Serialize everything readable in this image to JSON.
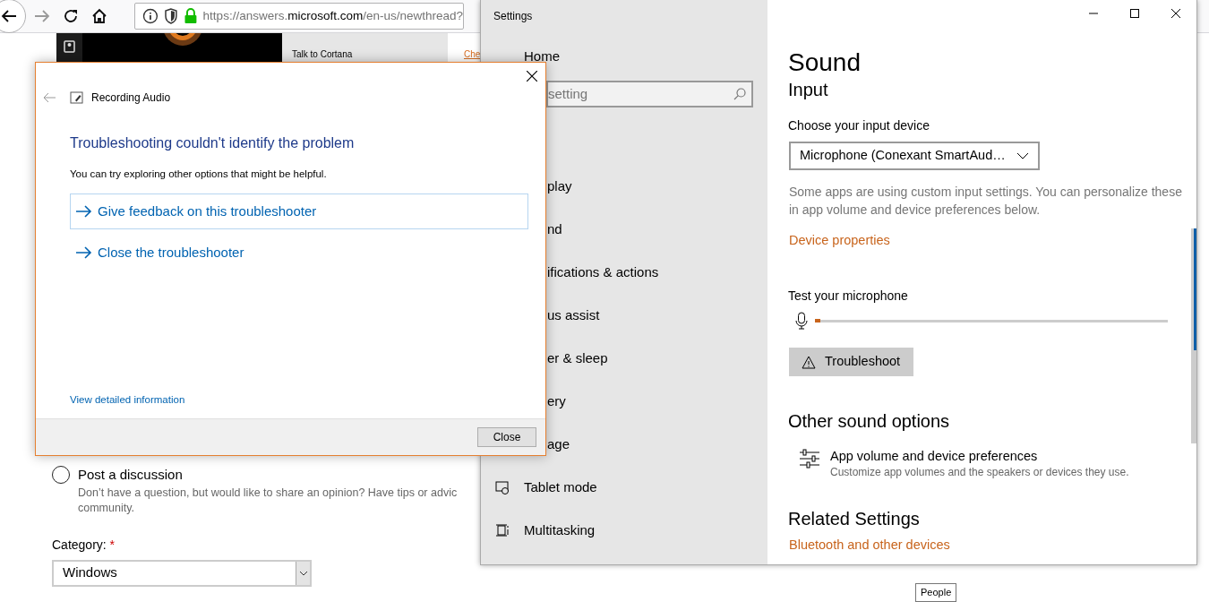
{
  "browser": {
    "address": {
      "url_prefix": "https://answers.",
      "url_host": "microsoft.com",
      "url_path": "/en-us/newthread?"
    }
  },
  "page": {
    "promo": {
      "caption": "Talk to Cortana",
      "link": "Che"
    },
    "post_option": {
      "label": "Post a discussion",
      "selected": false,
      "description_lines": [
        "Don’t have a question, but would like to share an opinion? Have tips or advic",
        "community."
      ]
    },
    "category": {
      "label": "Category:",
      "required_mark": "*",
      "value": "Windows"
    }
  },
  "settings": {
    "title": "Settings",
    "nav_home": "Home",
    "search": {
      "placeholder": "setting"
    },
    "nav_items": [
      {
        "label": "play",
        "kind": "partial"
      },
      {
        "label": "nd",
        "kind": "partial"
      },
      {
        "label": "ifications & actions",
        "kind": "partial"
      },
      {
        "label": "us assist",
        "kind": "partial"
      },
      {
        "label": "er & sleep",
        "kind": "partial"
      },
      {
        "label": "ery",
        "kind": "partial"
      },
      {
        "label": "age",
        "kind": "partial"
      },
      {
        "label": "Tablet mode",
        "kind": "full"
      },
      {
        "label": "Multitasking",
        "kind": "full"
      }
    ],
    "heading": "Sound",
    "section": "Input",
    "device_label": "Choose your input device",
    "device_value": "Microphone (Conexant SmartAud…",
    "hint": "Some apps are using custom input settings. You can personalize these in app volume and device preferences below.",
    "device_link": "Device properties",
    "test_label": "Test your microphone",
    "mic_meter": {
      "level": 0.015
    },
    "troubleshoot": "Troubleshoot",
    "other_heading": "Other sound options",
    "app_volume": {
      "title": "App volume and device preferences",
      "description": "Customize app volumes and the speakers or devices they use."
    },
    "related_heading": "Related Settings",
    "related_link": "Bluetooth and other devices"
  },
  "dialog": {
    "title": "Recording Audio",
    "heading": "Troubleshooting couldn't identify the problem",
    "body": "You can try exploring other options that might be helpful.",
    "options": [
      {
        "label": "Give feedback on this troubleshooter",
        "focused": true
      },
      {
        "label": "Close the troubleshooter",
        "focused": false
      }
    ],
    "details_link": "View detailed information",
    "close_button": "Close"
  },
  "tooltip": "People"
}
